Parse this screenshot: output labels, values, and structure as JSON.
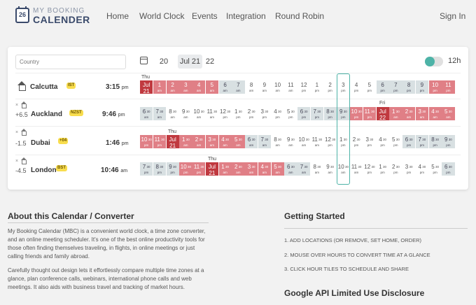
{
  "header": {
    "logo_number": "26",
    "logo_line1": "MY BOOKING",
    "logo_line2": "CALENDER",
    "nav": [
      "Home",
      "World Clock",
      "Events",
      "Integration",
      "Round Robin"
    ],
    "sign_in": "Sign In"
  },
  "toolbar": {
    "country_placeholder": "Country",
    "dates": [
      "20",
      "Jul 21",
      "22"
    ],
    "active_date_index": 1,
    "format_label": "12h",
    "format_toggle_on": false
  },
  "colors": {
    "accent": "#4db3a7",
    "night": "#e07f86",
    "midnight": "#c0393f",
    "dawn": "#d8e0e2",
    "badge": "#f8dd4e"
  },
  "locations": [
    {
      "city": "Calcutta",
      "badge": "IST",
      "offset": "",
      "is_home": true,
      "time": "3:15",
      "ampm": "pm",
      "day_label": "Thu",
      "tiles": [
        {
          "h": "Jul",
          "s": "21",
          "k": "midnight"
        },
        {
          "h": "1",
          "s": "am",
          "k": "night"
        },
        {
          "h": "2",
          "s": "am",
          "k": "night"
        },
        {
          "h": "3",
          "s": "am",
          "k": "night"
        },
        {
          "h": "4",
          "s": "am",
          "k": "night"
        },
        {
          "h": "5",
          "s": "am",
          "k": "night"
        },
        {
          "h": "6",
          "s": "am",
          "k": "dawn"
        },
        {
          "h": "7",
          "s": "am",
          "k": "dawn"
        },
        {
          "h": "8",
          "s": "am",
          "k": "work"
        },
        {
          "h": "9",
          "s": "am",
          "k": "work"
        },
        {
          "h": "10",
          "s": "am",
          "k": "work"
        },
        {
          "h": "11",
          "s": "am",
          "k": "work"
        },
        {
          "h": "12",
          "s": "pm",
          "k": "work"
        },
        {
          "h": "1",
          "s": "pm",
          "k": "work"
        },
        {
          "h": "2",
          "s": "pm",
          "k": "work"
        },
        {
          "h": "3",
          "s": "pm",
          "k": "work"
        },
        {
          "h": "4",
          "s": "pm",
          "k": "work"
        },
        {
          "h": "5",
          "s": "pm",
          "k": "work"
        },
        {
          "h": "6",
          "s": "pm",
          "k": "dawn"
        },
        {
          "h": "7",
          "s": "pm",
          "k": "dawn"
        },
        {
          "h": "8",
          "s": "pm",
          "k": "dawn"
        },
        {
          "h": "9",
          "s": "pm",
          "k": "dawn"
        },
        {
          "h": "10",
          "s": "pm",
          "k": "night"
        },
        {
          "h": "11",
          "s": "pm",
          "k": "night"
        }
      ]
    },
    {
      "city": "Auckland",
      "badge": "NZST",
      "offset": "+6.5",
      "is_home": false,
      "time": "9:46",
      "ampm": "pm",
      "day_label": "Fri",
      "tiles": [
        {
          "h": "6",
          "sub": "30",
          "s": "am",
          "k": "dawn"
        },
        {
          "h": "7",
          "sub": "30",
          "s": "am",
          "k": "dawn"
        },
        {
          "h": "8",
          "sub": "30",
          "s": "am",
          "k": "work"
        },
        {
          "h": "9",
          "sub": "30",
          "s": "am",
          "k": "work"
        },
        {
          "h": "10",
          "sub": "30",
          "s": "am",
          "k": "work"
        },
        {
          "h": "11",
          "sub": "30",
          "s": "am",
          "k": "work"
        },
        {
          "h": "12",
          "sub": "30",
          "s": "pm",
          "k": "work"
        },
        {
          "h": "1",
          "sub": "30",
          "s": "pm",
          "k": "work"
        },
        {
          "h": "2",
          "sub": "30",
          "s": "pm",
          "k": "work"
        },
        {
          "h": "3",
          "sub": "30",
          "s": "pm",
          "k": "work"
        },
        {
          "h": "4",
          "sub": "30",
          "s": "pm",
          "k": "work"
        },
        {
          "h": "5",
          "sub": "30",
          "s": "pm",
          "k": "work"
        },
        {
          "h": "6",
          "sub": "30",
          "s": "pm",
          "k": "dawn"
        },
        {
          "h": "7",
          "sub": "30",
          "s": "pm",
          "k": "dawn"
        },
        {
          "h": "8",
          "sub": "30",
          "s": "pm",
          "k": "dawn"
        },
        {
          "h": "9",
          "sub": "30",
          "s": "pm",
          "k": "dawn"
        },
        {
          "h": "10",
          "sub": "30",
          "s": "pm",
          "k": "night"
        },
        {
          "h": "11",
          "sub": "30",
          "s": "pm",
          "k": "night"
        },
        {
          "h": "Jul",
          "s": "22",
          "k": "midnight"
        },
        {
          "h": "1",
          "sub": "30",
          "s": "am",
          "k": "night"
        },
        {
          "h": "2",
          "sub": "30",
          "s": "am",
          "k": "night"
        },
        {
          "h": "3",
          "sub": "30",
          "s": "am",
          "k": "night"
        },
        {
          "h": "4",
          "sub": "30",
          "s": "am",
          "k": "night"
        },
        {
          "h": "5",
          "sub": "30",
          "s": "am",
          "k": "night"
        }
      ]
    },
    {
      "city": "Dubai",
      "badge": "+04",
      "offset": "-1.5",
      "is_home": false,
      "time": "1:46",
      "ampm": "pm",
      "day_label": "Thu",
      "tiles": [
        {
          "h": "10",
          "sub": "30",
          "s": "pm",
          "k": "night"
        },
        {
          "h": "11",
          "sub": "30",
          "s": "pm",
          "k": "night"
        },
        {
          "h": "Jul",
          "s": "21",
          "k": "midnight"
        },
        {
          "h": "1",
          "sub": "30",
          "s": "am",
          "k": "night"
        },
        {
          "h": "2",
          "sub": "30",
          "s": "am",
          "k": "night"
        },
        {
          "h": "3",
          "sub": "30",
          "s": "am",
          "k": "night"
        },
        {
          "h": "4",
          "sub": "30",
          "s": "am",
          "k": "night"
        },
        {
          "h": "5",
          "sub": "30",
          "s": "am",
          "k": "night"
        },
        {
          "h": "6",
          "sub": "30",
          "s": "am",
          "k": "dawn"
        },
        {
          "h": "7",
          "sub": "30",
          "s": "am",
          "k": "dawn"
        },
        {
          "h": "8",
          "sub": "30",
          "s": "am",
          "k": "work"
        },
        {
          "h": "9",
          "sub": "30",
          "s": "am",
          "k": "work"
        },
        {
          "h": "10",
          "sub": "30",
          "s": "am",
          "k": "work"
        },
        {
          "h": "11",
          "sub": "30",
          "s": "am",
          "k": "work"
        },
        {
          "h": "12",
          "sub": "30",
          "s": "pm",
          "k": "work"
        },
        {
          "h": "1",
          "sub": "30",
          "s": "pm",
          "k": "work"
        },
        {
          "h": "2",
          "sub": "30",
          "s": "pm",
          "k": "work"
        },
        {
          "h": "3",
          "sub": "30",
          "s": "pm",
          "k": "work"
        },
        {
          "h": "4",
          "sub": "30",
          "s": "pm",
          "k": "work"
        },
        {
          "h": "5",
          "sub": "30",
          "s": "pm",
          "k": "work"
        },
        {
          "h": "6",
          "sub": "30",
          "s": "pm",
          "k": "dawn"
        },
        {
          "h": "7",
          "sub": "30",
          "s": "pm",
          "k": "dawn"
        },
        {
          "h": "8",
          "sub": "30",
          "s": "pm",
          "k": "dawn"
        },
        {
          "h": "9",
          "sub": "30",
          "s": "pm",
          "k": "dawn"
        }
      ]
    },
    {
      "city": "London",
      "badge": "BST",
      "offset": "-4.5",
      "is_home": false,
      "time": "10:46",
      "ampm": "am",
      "day_label": "Thu",
      "tiles": [
        {
          "h": "7",
          "sub": "30",
          "s": "pm",
          "k": "dawn"
        },
        {
          "h": "8",
          "sub": "30",
          "s": "pm",
          "k": "dawn"
        },
        {
          "h": "9",
          "sub": "30",
          "s": "pm",
          "k": "dawn"
        },
        {
          "h": "10",
          "sub": "30",
          "s": "pm",
          "k": "night"
        },
        {
          "h": "11",
          "sub": "30",
          "s": "pm",
          "k": "night"
        },
        {
          "h": "Jul",
          "s": "21",
          "k": "midnight"
        },
        {
          "h": "1",
          "sub": "30",
          "s": "am",
          "k": "night"
        },
        {
          "h": "2",
          "sub": "30",
          "s": "am",
          "k": "night"
        },
        {
          "h": "3",
          "sub": "30",
          "s": "am",
          "k": "night"
        },
        {
          "h": "4",
          "sub": "30",
          "s": "am",
          "k": "night"
        },
        {
          "h": "5",
          "sub": "30",
          "s": "am",
          "k": "night"
        },
        {
          "h": "6",
          "sub": "30",
          "s": "am",
          "k": "dawn"
        },
        {
          "h": "7",
          "sub": "30",
          "s": "am",
          "k": "dawn"
        },
        {
          "h": "8",
          "sub": "30",
          "s": "am",
          "k": "work"
        },
        {
          "h": "9",
          "sub": "30",
          "s": "am",
          "k": "work"
        },
        {
          "h": "10",
          "sub": "30",
          "s": "am",
          "k": "work"
        },
        {
          "h": "11",
          "sub": "30",
          "s": "am",
          "k": "work"
        },
        {
          "h": "12",
          "sub": "30",
          "s": "pm",
          "k": "work"
        },
        {
          "h": "1",
          "sub": "30",
          "s": "pm",
          "k": "work"
        },
        {
          "h": "2",
          "sub": "30",
          "s": "pm",
          "k": "work"
        },
        {
          "h": "3",
          "sub": "30",
          "s": "pm",
          "k": "work"
        },
        {
          "h": "4",
          "sub": "30",
          "s": "pm",
          "k": "work"
        },
        {
          "h": "5",
          "sub": "30",
          "s": "pm",
          "k": "work"
        },
        {
          "h": "6",
          "sub": "30",
          "s": "pm",
          "k": "dawn"
        }
      ]
    }
  ],
  "about": {
    "title": "About this Calendar / Converter",
    "p1": "My Booking Calendar (MBC) is a convenient world clock, a time zone converter, and an online meeting scheduler. It's one of the best online productivity tools for those often finding themselves traveling, in flights, in online meetings or just calling friends and family abroad.",
    "p2": "Carefully thought out design lets it effortlessly compare multiple time zones at a glance, plan conference calls, webinars, international phone calls and web meetings. It also aids with business travel and tracking of market hours."
  },
  "getting_started": {
    "title": "Getting Started",
    "steps": [
      "1. ADD LOCATIONS (OR REMOVE, SET HOME, ORDER)",
      "2. MOUSE OVER HOURS TO CONVERT TIME AT A GLANCE",
      "3. CLICK HOUR TILES TO SCHEDULE AND SHARE"
    ],
    "google_title": "Google API Limited Use Disclosure"
  }
}
